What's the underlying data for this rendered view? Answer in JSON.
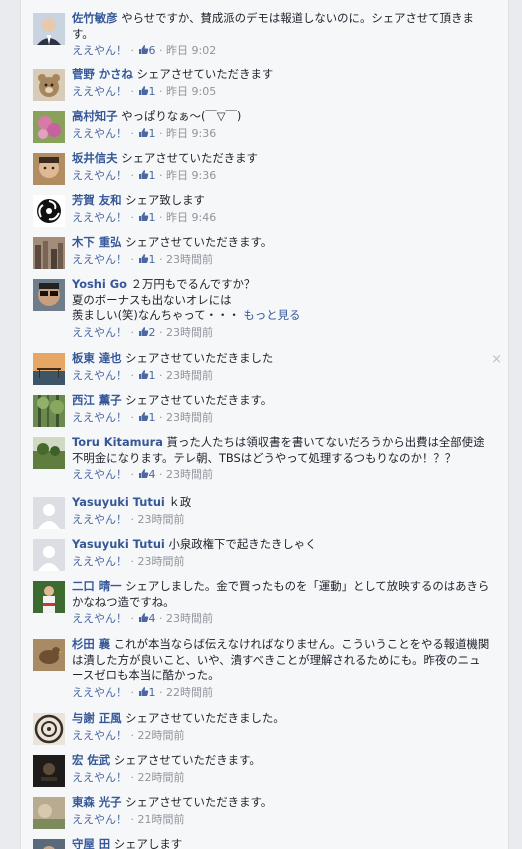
{
  "comments": [
    {
      "name": "佐竹敏彦",
      "text": "やらせですか、賛成派のデモは報道しないのに。シェアさせて頂きます。",
      "like_label": "ええやん！",
      "likes": "6",
      "time": "昨日 9:02",
      "avatar": "avatar-portrait-suit"
    },
    {
      "name": "菅野 かさね",
      "text": "シェアさせていただきます",
      "like_label": "ええやん！",
      "likes": "1",
      "time": "昨日 9:05",
      "avatar": "avatar-bear"
    },
    {
      "name": "高村知子",
      "text": "やっぱりなぁ〜(￣▽￣)",
      "like_label": "ええやん！",
      "likes": "1",
      "time": "昨日 9:36",
      "avatar": "avatar-pink-flower"
    },
    {
      "name": "坂井信夫",
      "text": "シェアさせていただきます",
      "like_label": "ええやん！",
      "likes": "1",
      "time": "昨日 9:36",
      "avatar": "avatar-man-face"
    },
    {
      "name": "芳賀 友和",
      "text": "シェア致します",
      "like_label": "ええやん！",
      "likes": "1",
      "time": "昨日 9:46",
      "avatar": "avatar-tomoe-symbol"
    },
    {
      "name": "木下 重弘",
      "text": "シェアさせていただきます。",
      "like_label": "ええやん！",
      "likes": "1",
      "time": "23時間前",
      "avatar": "avatar-city"
    },
    {
      "name": "Yoshi Go",
      "text": "２万円もでるんですか？\n夏のボーナスも出ないオレには\n羨ましい(笑)なんちゃって・・・",
      "more": "もっと見る",
      "like_label": "ええやん！",
      "likes": "2",
      "time": "23時間前",
      "avatar": "avatar-sunglasses"
    },
    {
      "name": "板東 達也",
      "text": "シェアさせていただきました",
      "like_label": "ええやん！",
      "likes": "1",
      "time": "23時間前",
      "avatar": "avatar-dock-sunset",
      "close": "×"
    },
    {
      "name": "西江 薫子",
      "text": "シェアさせていただきます。",
      "like_label": "ええやん！",
      "likes": "1",
      "time": "23時間前",
      "avatar": "avatar-forest"
    },
    {
      "name": "Toru Kitamura",
      "text": "貰った人たちは領収書を書いてないだろうから出費は全部使途不明金になります。テレ朝、TBSはどうやって処理するつもりなのか！？？",
      "like_label": "ええやん！",
      "likes": "4",
      "time": "23時間前",
      "avatar": "avatar-landscape"
    },
    {
      "name": "Yasuyuki Tutui",
      "text": "ｋ政",
      "like_label": "ええやん！",
      "likes": "",
      "time": "23時間前",
      "avatar": "avatar-default"
    },
    {
      "name": "Yasuyuki Tutui",
      "text": "小泉政権下で起きたきしゃく",
      "like_label": "ええやん！",
      "likes": "",
      "time": "23時間前",
      "avatar": "avatar-default"
    },
    {
      "name": "二口 晴一",
      "text": "シェアしました。金で買ったものを「運動」として放映するのはあきらかなねつ造ですね。",
      "like_label": "ええやん！",
      "likes": "4",
      "time": "23時間前",
      "avatar": "avatar-festival"
    },
    {
      "name": "杉田 襄",
      "text": "これが本当ならば伝えなければなりません。こういうことをやる報道機関は潰した方が良いこと、いや、潰すべきことが理解されるためにも。昨夜のニュースゼロも本当に酷かった。",
      "like_label": "ええやん！",
      "likes": "1",
      "time": "22時間前",
      "avatar": "avatar-bird"
    },
    {
      "name": "与謝 正風",
      "text": "シェアさせていただきました。",
      "like_label": "ええやん！",
      "likes": "",
      "time": "22時間前",
      "avatar": "avatar-crest"
    },
    {
      "name": "宏 佐武",
      "text": "シェアさせていただきます。",
      "like_label": "ええやん！",
      "likes": "",
      "time": "22時間前",
      "avatar": "avatar-dark-photo"
    },
    {
      "name": "東森 光子",
      "text": "シェアさせていただきます。",
      "like_label": "ええやん！",
      "likes": "",
      "time": "21時間前",
      "avatar": "avatar-garden"
    },
    {
      "name": "守屋 田",
      "text": "シェアします",
      "like_label": "",
      "likes": "",
      "time": "",
      "avatar": "avatar-partial"
    }
  ]
}
